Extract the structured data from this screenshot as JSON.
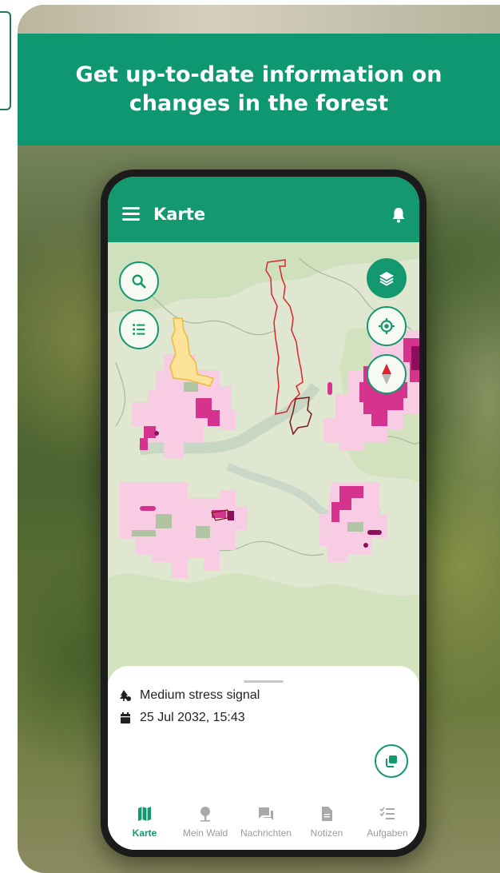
{
  "banner": {
    "headline": "Get up-to-date information on changes in the forest"
  },
  "app": {
    "title": "Karte",
    "colors": {
      "primary": "#13986f",
      "banner": "#0e9770",
      "high_stress": "#d6338f",
      "low_stress": "#f8cde3",
      "boundary": "#e0242c",
      "selected_area": "#fde39a"
    }
  },
  "map_controls": {
    "search_icon": "search-icon",
    "list_icon": "list-icon",
    "layers_icon": "layers-icon",
    "locate_icon": "crosshair-icon",
    "compass_icon": "compass-icon"
  },
  "details": {
    "signal": "Medium stress signal",
    "datetime": "25 Jul 2032, 15:43",
    "copy_icon": "copy-icon"
  },
  "nav": {
    "items": [
      {
        "label": "Karte",
        "icon": "map-icon",
        "active": true
      },
      {
        "label": "Mein Wald",
        "icon": "tree-icon",
        "active": false
      },
      {
        "label": "Nachrichten",
        "icon": "chat-icon",
        "active": false
      },
      {
        "label": "Notizen",
        "icon": "note-icon",
        "active": false
      },
      {
        "label": "Aufgaben",
        "icon": "tasks-icon",
        "active": false
      }
    ]
  }
}
